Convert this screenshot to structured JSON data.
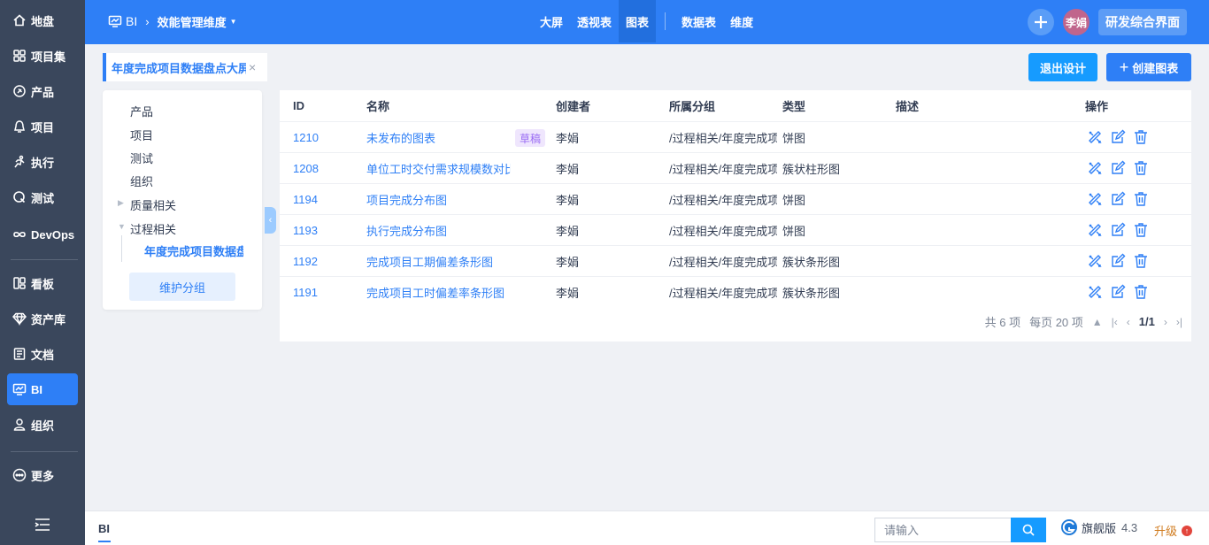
{
  "sidebar": {
    "items": [
      {
        "label": "地盘",
        "icon": "home-icon"
      },
      {
        "label": "项目集",
        "icon": "grid-icon"
      },
      {
        "label": "产品",
        "icon": "product-icon"
      },
      {
        "label": "项目",
        "icon": "project-icon"
      },
      {
        "label": "执行",
        "icon": "run-icon"
      },
      {
        "label": "测试",
        "icon": "test-icon"
      },
      {
        "label": "DevOps",
        "icon": "infinity-icon"
      },
      {
        "label": "看板",
        "icon": "kanban-icon"
      },
      {
        "label": "资产库",
        "icon": "diamond-icon"
      },
      {
        "label": "文档",
        "icon": "doc-icon"
      },
      {
        "label": "BI",
        "icon": "bi-icon",
        "active": true
      },
      {
        "label": "组织",
        "icon": "user-icon"
      },
      {
        "label": "更多",
        "icon": "more-icon"
      }
    ]
  },
  "header": {
    "bi_label": "BI",
    "current": "效能管理维度",
    "tabs": [
      "大屏",
      "透视表",
      "图表"
    ],
    "tabs2": [
      "数据表",
      "维度"
    ],
    "active_tab": "图表",
    "avatar": "李娟",
    "switch_label": "研发综合界面"
  },
  "page_tab": {
    "title": "年度完成项目数据盘点大屏",
    "close": "×"
  },
  "actions": {
    "exit": "退出设计",
    "create": "创建图表",
    "create_plus": "+"
  },
  "tree": {
    "items": [
      "产品",
      "项目",
      "测试",
      "组织",
      "质量相关",
      "过程相关"
    ],
    "child": "年度完成项目数据盘点大屏",
    "maintain": "维护分组"
  },
  "table": {
    "headers": [
      "ID",
      "名称",
      "创建者",
      "所属分组",
      "类型",
      "描述",
      "操作"
    ],
    "rows": [
      {
        "id": "1210",
        "name": "未发布的图表",
        "badge": "草稿",
        "creator": "李娟",
        "group": "/过程相关/年度完成项目数据盘点大屏",
        "type": "饼图",
        "desc": ""
      },
      {
        "id": "1208",
        "name": "单位工时交付需求规模数对比",
        "badge": "",
        "creator": "李娟",
        "group": "/过程相关/年度完成项目数据盘点大屏",
        "type": "簇状柱形图",
        "desc": ""
      },
      {
        "id": "1194",
        "name": "项目完成分布图",
        "badge": "",
        "creator": "李娟",
        "group": "/过程相关/年度完成项目数据盘点大屏",
        "type": "饼图",
        "desc": ""
      },
      {
        "id": "1193",
        "name": "执行完成分布图",
        "badge": "",
        "creator": "李娟",
        "group": "/过程相关/年度完成项目数据盘点大屏",
        "type": "饼图",
        "desc": ""
      },
      {
        "id": "1192",
        "name": "完成项目工期偏差条形图",
        "badge": "",
        "creator": "李娟",
        "group": "/过程相关/年度完成项目数据盘点大屏",
        "type": "簇状条形图",
        "desc": ""
      },
      {
        "id": "1191",
        "name": "完成项目工时偏差率条形图",
        "badge": "",
        "creator": "李娟",
        "group": "/过程相关/年度完成项目数据盘点大屏",
        "type": "簇状条形图",
        "desc": ""
      }
    ],
    "pager": {
      "total": "共 6 项",
      "per_page": "每页 20 项",
      "page": "1/1"
    }
  },
  "footer": {
    "tab": "BI",
    "search_placeholder": "请输入",
    "edition": "旗舰版",
    "version": "4.3",
    "upgrade": "升级",
    "upgrade_dot": "↑"
  },
  "colors": {
    "primary": "#2e7ff6",
    "sidebar": "#3a475c",
    "accent": "#169bff"
  }
}
